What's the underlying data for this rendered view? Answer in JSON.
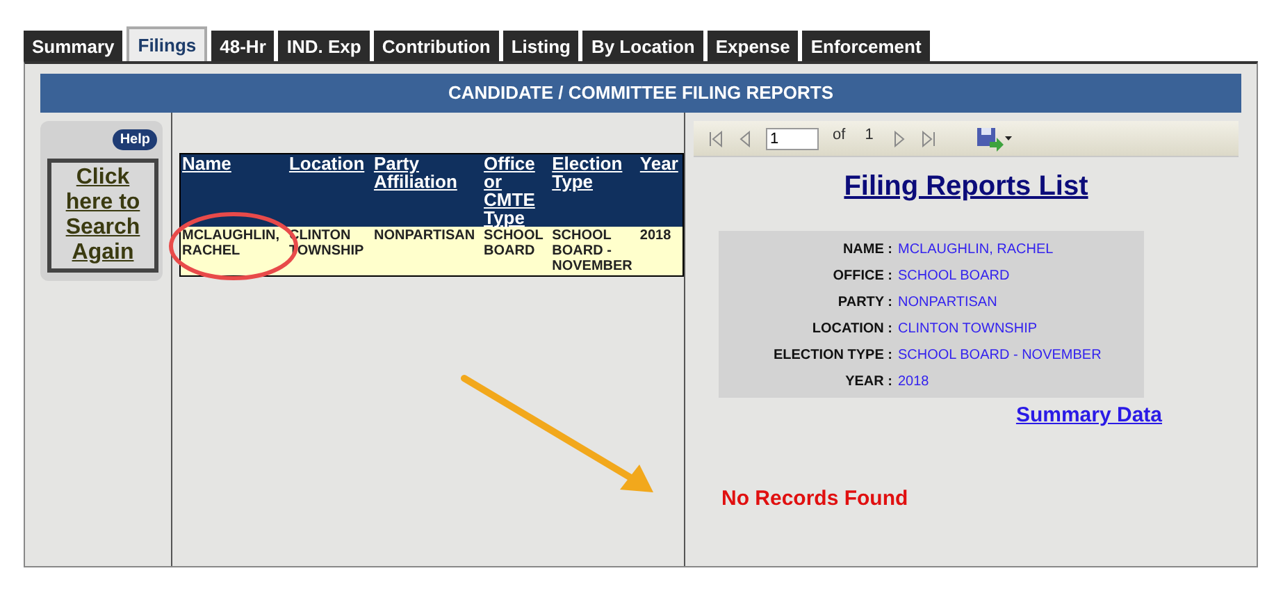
{
  "tabs": [
    {
      "label": "Summary",
      "selected": false
    },
    {
      "label": "Filings",
      "selected": true
    },
    {
      "label": "48-Hr",
      "selected": false
    },
    {
      "label": "IND. Exp",
      "selected": false
    },
    {
      "label": "Contribution",
      "selected": false
    },
    {
      "label": "Listing",
      "selected": false
    },
    {
      "label": "By Location",
      "selected": false
    },
    {
      "label": "Expense",
      "selected": false
    },
    {
      "label": "Enforcement",
      "selected": false
    }
  ],
  "header": "CANDIDATE / COMMITTEE FILING REPORTS",
  "sidebar": {
    "help": "Help",
    "search_again": "Click here to Search Again"
  },
  "table": {
    "columns": [
      "Name",
      "Location",
      "Party Affiliation",
      "Office or CMTE Type",
      "Election Type",
      "Year"
    ],
    "rows": [
      [
        "MCLAUGHLIN, RACHEL",
        "CLINTON TOWNSHIP",
        "NONPARTISAN",
        "SCHOOL BOARD",
        "SCHOOL BOARD - NOVEMBER",
        "2018"
      ]
    ]
  },
  "report": {
    "toolbar": {
      "page": "1",
      "of": "of",
      "total": "1"
    },
    "title": "Filing Reports List",
    "details": [
      {
        "label": "NAME :",
        "value": "MCLAUGHLIN, RACHEL"
      },
      {
        "label": "OFFICE :",
        "value": "SCHOOL BOARD"
      },
      {
        "label": "PARTY :",
        "value": "NONPARTISAN"
      },
      {
        "label": "LOCATION :",
        "value": "CLINTON TOWNSHIP"
      },
      {
        "label": "ELECTION TYPE :",
        "value": "SCHOOL BOARD - NOVEMBER"
      },
      {
        "label": "YEAR :",
        "value": "2018"
      }
    ],
    "summary_link": "Summary Data",
    "message": "No Records Found"
  }
}
